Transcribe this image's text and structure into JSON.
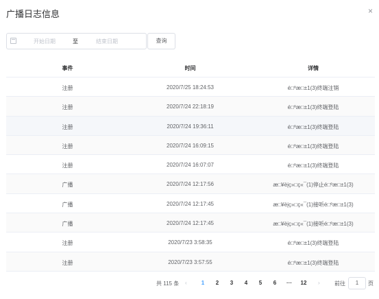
{
  "dialog": {
    "title": "广播日志信息",
    "close_glyph": "×"
  },
  "filter": {
    "start_placeholder": "开始日期",
    "separator": "至",
    "end_placeholder": "结束日期",
    "query_label": "查询",
    "calendar_icon": "calendar-icon"
  },
  "table": {
    "headers": [
      "事件",
      "时间",
      "详情"
    ],
    "rows": [
      [
        "注册",
        "2020/7/25 18:24:53",
        "é□ºæ□±1(3)终端注销"
      ],
      [
        "注册",
        "2020/7/24 22:18:19",
        "é□ºæ□±1(3)终端登陆"
      ],
      [
        "注册",
        "2020/7/24 19:36:11",
        "é□ºæ□±1(3)终端登陆"
      ],
      [
        "注册",
        "2020/7/24 16:09:15",
        "é□ºæ□±1(3)终端登陆"
      ],
      [
        "注册",
        "2020/7/24 16:07:07",
        "é□ºæ□±1(3)终端登陆"
      ],
      [
        "广播",
        "2020/7/24 12:17:56",
        "æ□¥èįç»□ç«¯(1)停止é□ºæ□±1(3)"
      ],
      [
        "广播",
        "2020/7/24 12:17:45",
        "æ□¥èįç»□ç«¯(1)接听é□ºæ□±1(3)"
      ],
      [
        "广播",
        "2020/7/24 12:17:45",
        "æ□¥èįç»□ç«¯(1)接听é□ºæ□±1(3)"
      ],
      [
        "注册",
        "2020/7/23 3:58:35",
        "é□ºæ□±1(3)终端登陆"
      ],
      [
        "注册",
        "2020/7/23 3:57:55",
        "é□ºæ□±1(3)终端登陆"
      ]
    ]
  },
  "pagination": {
    "total_text": "共 115 条",
    "prev": "‹",
    "pages": [
      "1",
      "2",
      "3",
      "4",
      "5",
      "6"
    ],
    "ellipsis": "···",
    "last_page": "12",
    "next": "›",
    "goto_label": "前往",
    "goto_value": "1",
    "page_unit": "页",
    "active_page": "1"
  },
  "colors": {
    "accent": "#409eff",
    "border": "#ebeef5",
    "stripe": "#fafafa"
  }
}
